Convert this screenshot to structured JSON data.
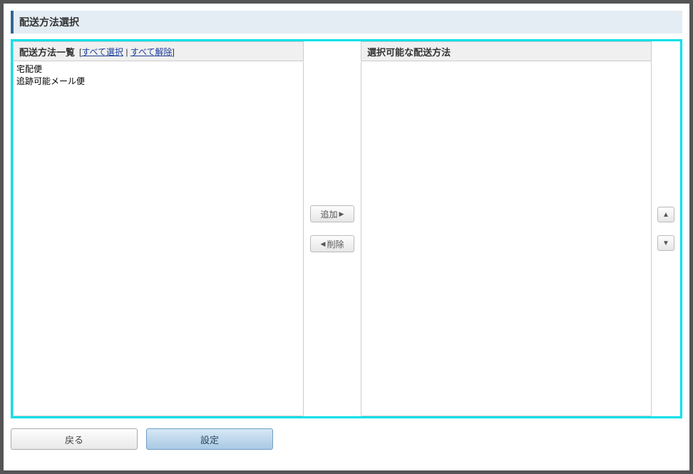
{
  "header": {
    "title": "配送方法選択"
  },
  "leftPanel": {
    "title": "配送方法一覧",
    "bracketOpen": " [",
    "selectAllLabel": "すべて選択",
    "sep": " | ",
    "clearAllLabel": "すべて解除",
    "bracketClose": "]",
    "items": [
      "宅配便",
      "追跡可能メール便"
    ]
  },
  "rightPanel": {
    "title": "選択可能な配送方法",
    "items": []
  },
  "controls": {
    "addLabel": "追加",
    "removeLabel": "削除"
  },
  "footer": {
    "backLabel": "戻る",
    "setLabel": "設定"
  }
}
